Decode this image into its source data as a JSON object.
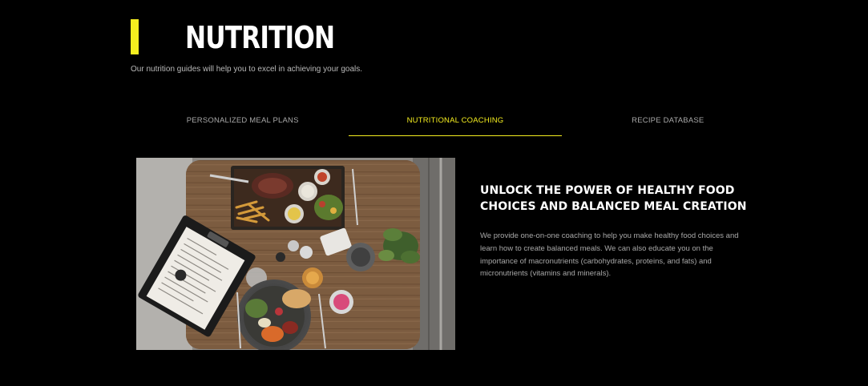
{
  "header": {
    "title": "NUTRITION",
    "subtitle": "Our nutrition guides will help you to excel in achieving your goals."
  },
  "tabs": [
    {
      "label": "PERSONALIZED MEAL PLANS",
      "active": false
    },
    {
      "label": "NUTRITIONAL COACHING",
      "active": true
    },
    {
      "label": "RECIPE DATABASE",
      "active": false
    }
  ],
  "content": {
    "heading": "UNLOCK THE POWER OF HEALTHY FOOD CHOICES AND BALANCED MEAL CREATION",
    "body": "We provide one-on-one coaching to help you make healthy food choices and learn how to create balanced meals. We can also educate you on the importance of macronutrients (carbohydrates, proteins, and fats) and micronutrients (vitamins and minerals)."
  },
  "colors": {
    "accent": "#f5ee1f",
    "background": "#000000",
    "text_muted": "#a8a8a8"
  }
}
